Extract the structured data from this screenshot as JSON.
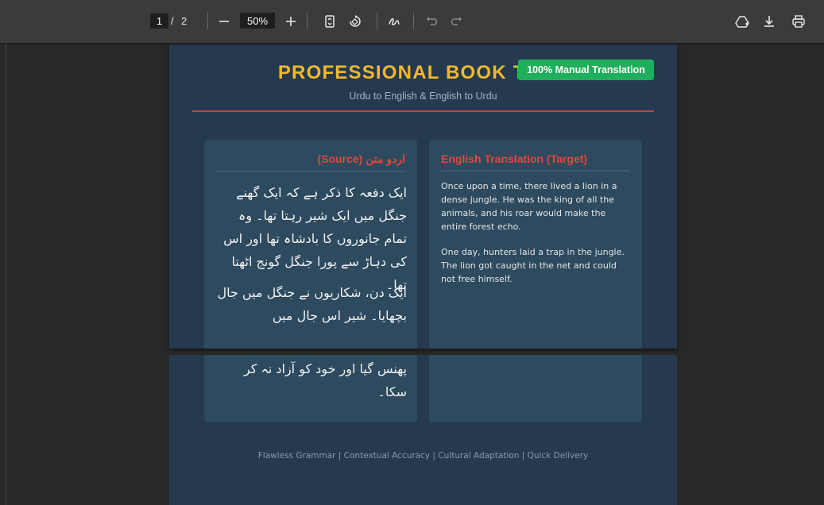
{
  "toolbar": {
    "current_page": "1",
    "page_separator": "/",
    "total_pages": "2",
    "zoom": "50%",
    "icons": {
      "zoom_out": "minus-icon",
      "zoom_in": "plus-icon",
      "fit_page": "fit-page-icon",
      "rotate": "rotate-icon",
      "draw": "draw-icon",
      "undo": "undo-icon",
      "redo": "redo-icon",
      "add_drive": "add-to-drive-icon",
      "download": "download-icon",
      "print": "print-icon"
    }
  },
  "document": {
    "title": "PROFESSIONAL BOOK TRAN",
    "badge": "100% Manual Translation",
    "subtitle": "Urdu to English & English to Urdu",
    "urdu_heading": "اردو متن (Source)",
    "english_heading": "English Translation (Target)",
    "urdu_para1": "ایک دفعہ کا ذکر ہے کہ ایک گھنے جنگل میں ایک شیر رہتا تھا۔ وہ تمام جانوروں کا بادشاہ تھا اور اس کی دہاڑ سے پورا جنگل گونج اٹھتا تھا۔",
    "urdu_para2_top": "ایک دن، شکاریوں نے جنگل میں جال بچھایا۔ شیر اس جال میں",
    "urdu_para2_bottom": "پھنس گیا اور خود کو آزاد نہ کر سکا۔",
    "english_para1": "Once upon a time, there lived a lion in a dense jungle. He was the king of all the animals, and his roar would make the entire forest echo.",
    "english_para2": "One day, hunters laid a trap in the jungle. The lion got caught in the net and could not free himself.",
    "footer": "Flawless Grammar | Contextual Accuracy | Cultural Adaptation | Quick Delivery"
  },
  "colors": {
    "page_bg": "#253a4f",
    "card_bg": "#2d4a5f",
    "title": "#f1b82d",
    "badge": "#1fae5b",
    "accent_red": "#e0483c"
  }
}
